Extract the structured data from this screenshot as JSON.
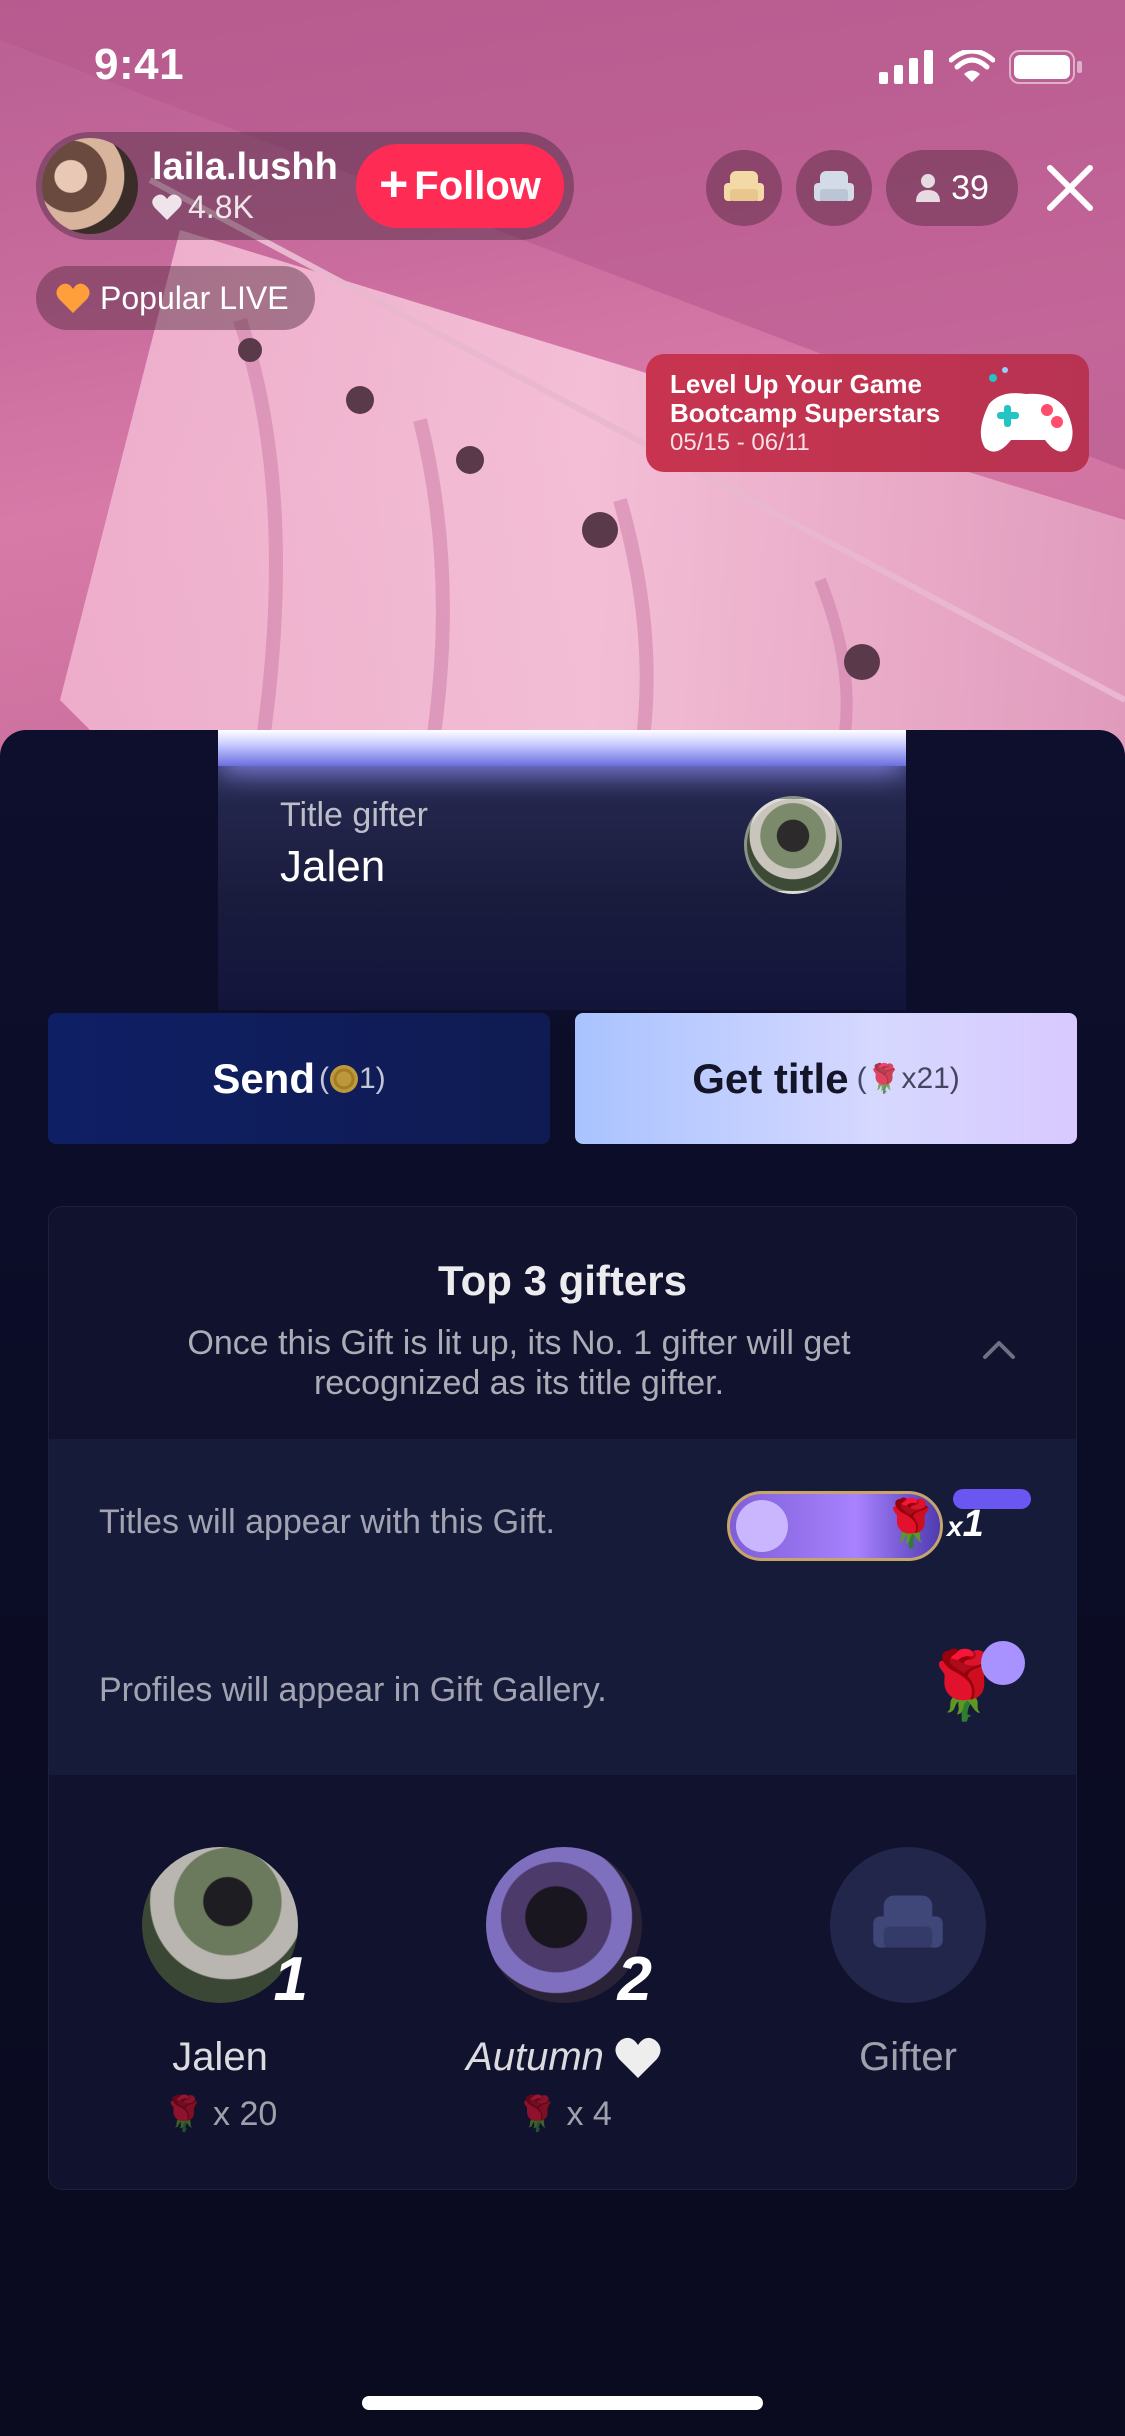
{
  "status_bar": {
    "time": "9:41"
  },
  "host": {
    "name": "laila.lushh",
    "likes": "4.8K",
    "follow_label": "Follow"
  },
  "viewer_count": "39",
  "popular_badge": "Popular LIVE",
  "promo": {
    "line1": "Level Up Your Game",
    "line2": "Bootcamp Superstars",
    "dates": "05/15 - 06/11"
  },
  "title_card": {
    "label": "Title gifter",
    "name": "Jalen"
  },
  "send_button": {
    "label": "Send",
    "cost_open": "(",
    "cost_value": "1)"
  },
  "get_title_button": {
    "label": "Get title",
    "cost_open": "(",
    "cost_value": "x21)"
  },
  "panel": {
    "title": "Top 3 gifters",
    "description": "Once this Gift is lit up, its No. 1 gifter will get recognized as its title gifter.",
    "row1_text": "Titles will appear with this Gift.",
    "row1_multiplier_x": "x",
    "row1_multiplier_n": "1",
    "row2_text": "Profiles will appear in Gift Gallery."
  },
  "gifters": [
    {
      "rank": "1",
      "name": "Jalen",
      "count": "x 20"
    },
    {
      "rank": "2",
      "name": "Autumn",
      "count": "x 4"
    },
    {
      "name": "Gifter"
    }
  ],
  "colors": {
    "follow": "#fe2c55",
    "send_bg": "#0f1f64",
    "get_title_bg": "#bfcaff",
    "panel_bg": "#10122e"
  }
}
